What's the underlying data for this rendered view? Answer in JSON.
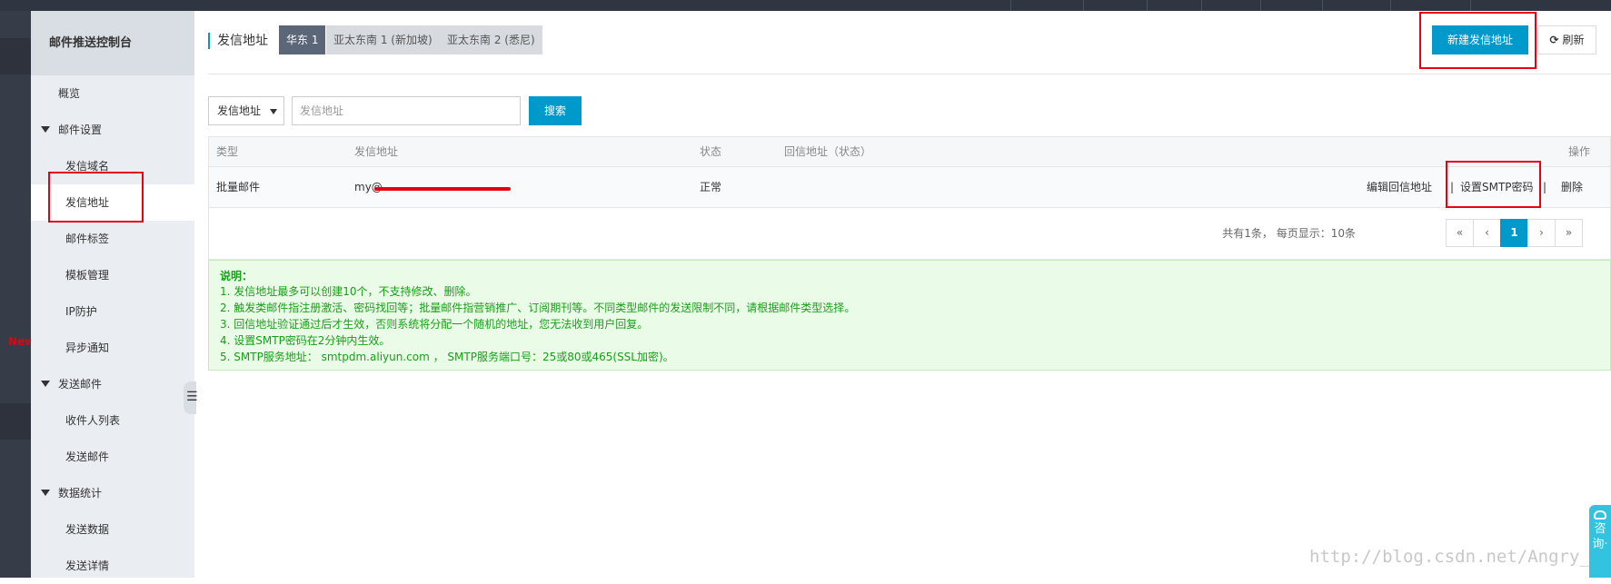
{
  "sidebar": {
    "title": "邮件推送控制台",
    "items": [
      {
        "label": "概览",
        "level": 1
      },
      {
        "label": "邮件设置",
        "level": 0
      },
      {
        "label": "发信域名",
        "level": 2
      },
      {
        "label": "发信地址",
        "level": 2,
        "active": true
      },
      {
        "label": "邮件标签",
        "level": 2
      },
      {
        "label": "模板管理",
        "level": 2
      },
      {
        "label": "IP防护",
        "level": 2
      },
      {
        "label": "异步通知",
        "level": 2
      },
      {
        "label": "发送邮件",
        "level": 0
      },
      {
        "label": "收件人列表",
        "level": 2
      },
      {
        "label": "发送邮件",
        "level": 2
      },
      {
        "label": "数据统计",
        "level": 0
      },
      {
        "label": "发送数据",
        "level": 2
      },
      {
        "label": "发送详情",
        "level": 2
      }
    ],
    "new_badge": "New",
    "collapse_icon": "list-icon"
  },
  "header": {
    "title": "发信地址",
    "regions": [
      "华东 1",
      "亚太东南 1 (新加坡)",
      "亚太东南 2 (悉尼)"
    ],
    "active_region": "华东 1",
    "new_button": "新建发信地址",
    "refresh_button": "刷新",
    "refresh_icon": "refresh-icon"
  },
  "search": {
    "select_value": "发信地址",
    "placeholder": "发信地址",
    "button": "搜索"
  },
  "table": {
    "columns": [
      "类型",
      "发信地址",
      "状态",
      "回信地址（状态）",
      "操作"
    ],
    "rows": [
      {
        "type": "批量邮件",
        "address": "my@",
        "status": "正常",
        "reply": "",
        "actions": [
          "编辑回信地址",
          "设置SMTP密码",
          "删除"
        ]
      }
    ]
  },
  "pagination": {
    "info": "共有1条， 每页显示：10条",
    "first": "«",
    "prev": "‹",
    "current": "1",
    "next": "›",
    "last": "»"
  },
  "notice": {
    "title": "说明：",
    "lines": [
      "1. 发信地址最多可以创建10个，不支持修改、删除。",
      "2. 触发类邮件指注册激活、密码找回等；批量邮件指营销推广、订阅期刊等。不同类型邮件的发送限制不同，请根据邮件类型选择。",
      "3. 回信地址验证通过后才生效，否则系统将分配一个随机的地址，您无法收到用户回复。",
      "4. 设置SMTP密码在2分钟内生效。",
      "5. SMTP服务地址： smtpdm.aliyun.com ， SMTP服务端口号：25或80或465(SSL加密)。"
    ]
  },
  "watermark": "http://blog.csdn.net/Angry_Mill",
  "consult": {
    "label": "咨询·",
    "icon": "chat-icon"
  },
  "colors": {
    "accent": "#0099cc",
    "highlight": "#e60012",
    "notice_text": "#18a018"
  }
}
